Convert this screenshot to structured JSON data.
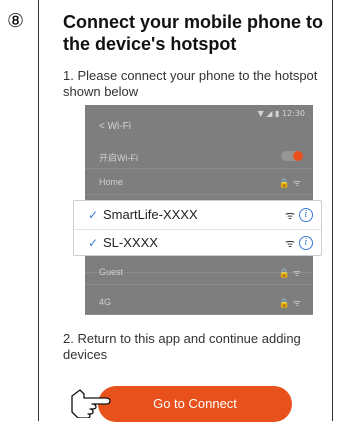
{
  "step": {
    "number": "⑧"
  },
  "title": "Connect your mobile phone to the device's hotspot",
  "instructions": {
    "step1": "1. Please connect your phone to the hotspot shown below",
    "step2": "2. Return to this app and continue adding devices"
  },
  "phone_screenshot": {
    "status_bar": "▼ ◢ ▮ 12:30",
    "header": "< Wi-Fi",
    "rows": [
      {
        "label": "开启Wi-Fi",
        "toggle_on": true
      },
      {
        "label": "Home",
        "icons": "🔒 ᯤ"
      },
      {
        "label": "",
        "icons": ""
      },
      {
        "label": "",
        "icons": ""
      },
      {
        "label": "",
        "icons": ""
      },
      {
        "label": "Guest",
        "icons": "🔒 ᯤ"
      },
      {
        "label": "4G",
        "icons": "🔒 ᯤ"
      }
    ]
  },
  "hotspot_popup": {
    "networks": [
      {
        "name": "SmartLife-XXXX",
        "check": "✓",
        "wifi": "ᯤ",
        "info": "i"
      },
      {
        "name": "SL-XXXX",
        "check": "✓",
        "wifi": "ᯤ",
        "info": "i"
      }
    ]
  },
  "buttons": {
    "connect_label": "Go to Connect"
  },
  "colors": {
    "accent": "#e8501c",
    "check": "#3a7bd5",
    "phone_bg": "#7e7e7e"
  }
}
